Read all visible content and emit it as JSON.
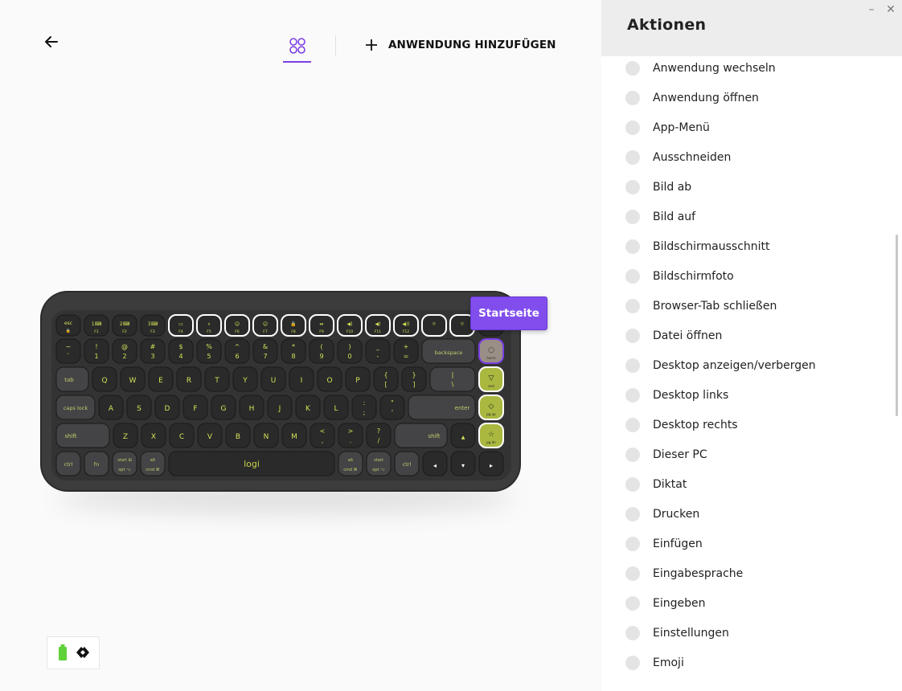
{
  "header": {
    "add_app_label": "ANWENDUNG HINZUFÜGEN"
  },
  "tooltip": {
    "label": "Startseite"
  },
  "keyboard": {
    "logo": "logi",
    "number_row": [
      {
        "top": "~",
        "bottom": "`"
      },
      {
        "top": "!",
        "bottom": "1"
      },
      {
        "top": "@",
        "bottom": "2"
      },
      {
        "top": "#",
        "bottom": "3"
      },
      {
        "top": "$",
        "bottom": "4"
      },
      {
        "top": "%",
        "bottom": "5"
      },
      {
        "top": "^",
        "bottom": "6"
      },
      {
        "top": "&",
        "bottom": "7"
      },
      {
        "top": "*",
        "bottom": "8"
      },
      {
        "top": "(",
        "bottom": "9"
      },
      {
        "top": ")",
        "bottom": "0"
      },
      {
        "top": "_",
        "bottom": "-"
      },
      {
        "top": "+",
        "bottom": "="
      }
    ],
    "backspace": "backspace",
    "tab": "tab",
    "row_q": [
      "Q",
      "W",
      "E",
      "R",
      "T",
      "Y",
      "U",
      "I",
      "O",
      "P"
    ],
    "row_q_extra": [
      {
        "top": "{",
        "bottom": "["
      },
      {
        "top": "}",
        "bottom": "]"
      },
      {
        "top": "|",
        "bottom": "\\"
      }
    ],
    "caps": "caps lock",
    "row_a": [
      "A",
      "S",
      "D",
      "F",
      "G",
      "H",
      "J",
      "K",
      "L"
    ],
    "row_a_extra": [
      {
        "top": ":",
        "bottom": ";"
      },
      {
        "top": "\"",
        "bottom": "'"
      }
    ],
    "enter": "enter",
    "shift": "shift",
    "row_z": [
      "Z",
      "X",
      "C",
      "V",
      "B",
      "N",
      "M"
    ],
    "row_z_extra": [
      {
        "top": "<",
        "bottom": ","
      },
      {
        "top": ">",
        "bottom": "."
      },
      {
        "top": "?",
        "bottom": "/"
      }
    ],
    "ctrl": "ctrl",
    "fn": "fn",
    "mod_left": [
      {
        "top": "start ⊞",
        "bottom": "opt ⌥"
      },
      {
        "top": "alt",
        "bottom": "cmd ⌘"
      }
    ],
    "mod_right": [
      {
        "top": "alt",
        "bottom": "cmd ⌘"
      },
      {
        "top": "start",
        "bottom": "opt ⌥"
      }
    ],
    "esc": "esc",
    "fkey_labels": [
      "F1",
      "F2",
      "F3",
      "F4",
      "F5",
      "F6",
      "F7",
      "F8",
      "F9",
      "F10",
      "F11",
      "F12"
    ],
    "side_keys": [
      "home",
      "end",
      "pg up",
      "pg dn"
    ]
  },
  "panel": {
    "title": "Aktionen",
    "items": [
      "Anwendung wechseln",
      "Anwendung öffnen",
      "App-Menü",
      "Ausschneiden",
      "Bild ab",
      "Bild auf",
      "Bildschirmausschnitt",
      "Bildschirmfoto",
      "Browser-Tab schließen",
      "Datei öffnen",
      "Desktop anzeigen/verbergen",
      "Desktop links",
      "Desktop rechts",
      "Dieser PC",
      "Diktat",
      "Drucken",
      "Einfügen",
      "Eingabesprache",
      "Eingeben",
      "Einstellungen",
      "Emoji"
    ]
  },
  "colors": {
    "accent": "#7b3fe4",
    "keyboard_body": "#3a3a3a",
    "key": "#2a2a2a",
    "legend": "#d4e157",
    "highlight_key": "#aab840"
  },
  "icons": [
    "back-arrow-icon",
    "apps-grid-icon",
    "plus-icon",
    "battery-icon",
    "connection-icon",
    "minimize-icon",
    "close-icon"
  ]
}
